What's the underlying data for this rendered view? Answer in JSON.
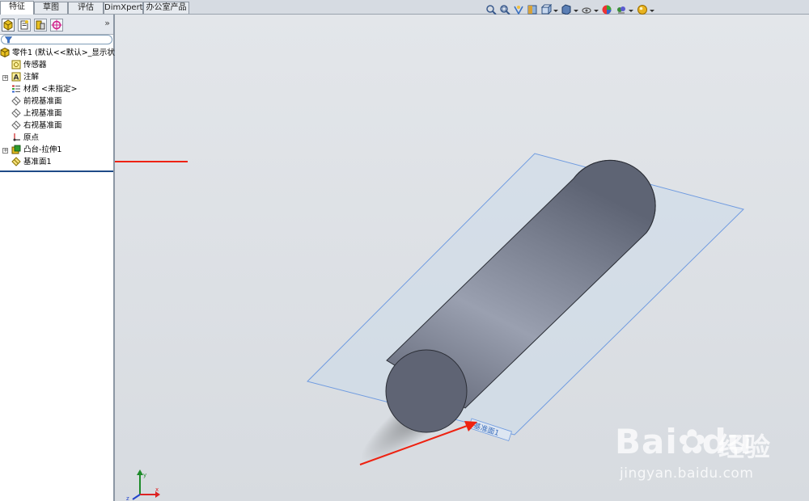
{
  "tabs": [
    {
      "label": "特征",
      "active": true
    },
    {
      "label": "草图",
      "active": false
    },
    {
      "label": "评估",
      "active": false
    },
    {
      "label": "DimXpert",
      "active": false
    },
    {
      "label": "办公室产品",
      "active": false
    }
  ],
  "panel": {
    "expand_label": "»",
    "tree": {
      "root": "零件1 (默认<<默认>_显示状态",
      "items": [
        {
          "label": "传感器",
          "icon": "sensor-icon"
        },
        {
          "label": "注解",
          "icon": "annotation-icon"
        },
        {
          "label": "材质 <未指定>",
          "icon": "material-icon"
        },
        {
          "label": "前视基准面",
          "icon": "plane-icon"
        },
        {
          "label": "上视基准面",
          "icon": "plane-icon"
        },
        {
          "label": "右视基准面",
          "icon": "plane-icon"
        },
        {
          "label": "原点",
          "icon": "origin-icon"
        },
        {
          "label": "凸台-拉伸1",
          "icon": "boss-extrude-icon"
        },
        {
          "label": "基准面1",
          "icon": "plane-icon"
        }
      ]
    }
  },
  "viewport": {
    "plane_label": "基准面1",
    "triad_axes": [
      "x",
      "y",
      "z"
    ]
  },
  "watermark": {
    "logo": "Bai",
    "logo_paw": "du",
    "cn": "经验",
    "url": "jingyan.baidu.com"
  },
  "colors": {
    "plane_edge": "#6f9be0",
    "cylinder": "#7b8090",
    "annotation_arrow": "#ee2211",
    "selection": "#1f4a87"
  }
}
